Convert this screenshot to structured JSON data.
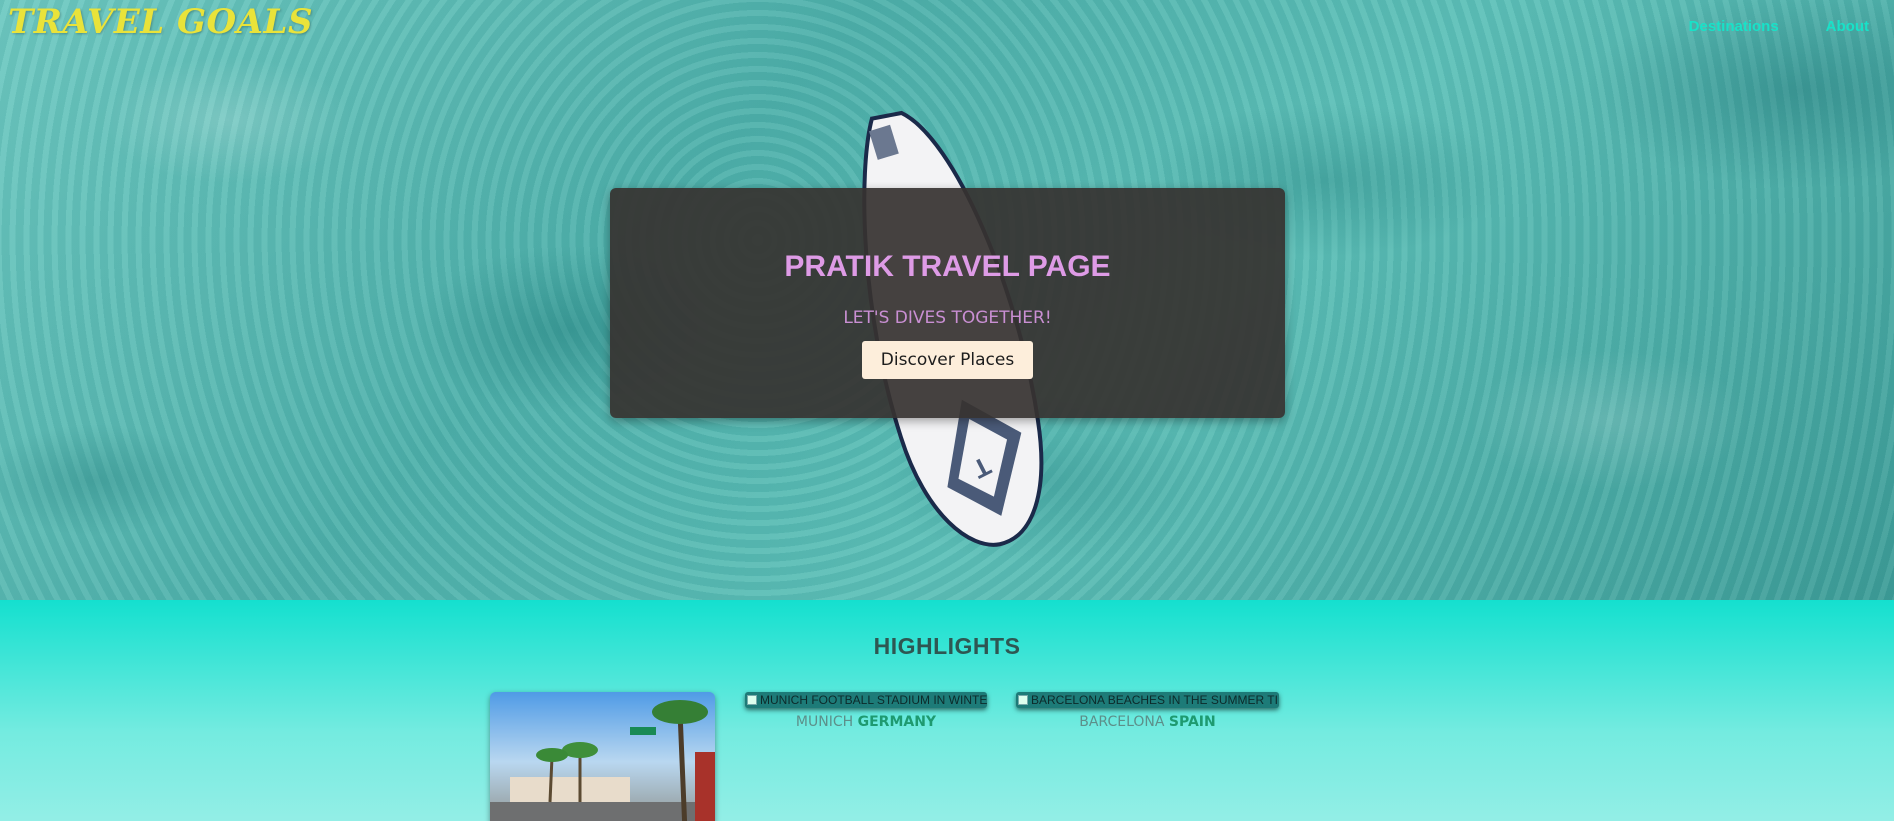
{
  "header": {
    "logo": "TRAVEL GOALS",
    "nav": [
      "Destinations",
      "About"
    ]
  },
  "hero": {
    "title": "PRATIK TRAVEL PAGE",
    "subtitle": "LET'S DIVES TOGETHER!",
    "button_label": "Discover Places",
    "colors": {
      "banner_bg": "#363230",
      "title": "#de9be6",
      "subtitle": "#c98fd3",
      "button_bg": "#fdeedb",
      "logo": "#e9e33a",
      "nav": "#18e2c8"
    }
  },
  "highlights": {
    "heading": "HIGHLIGHTS",
    "cards": [
      {
        "image_alt": "",
        "city": "",
        "country": ""
      },
      {
        "image_alt": "MUNICH FOOTBALL STADIUM IN WINTER",
        "city": "MUNICH",
        "country": "GERMANY"
      },
      {
        "image_alt": "BARCELONA BEACHES IN THE SUMMER TIME",
        "city": "BARCELONA",
        "country": "SPAIN"
      }
    ]
  }
}
